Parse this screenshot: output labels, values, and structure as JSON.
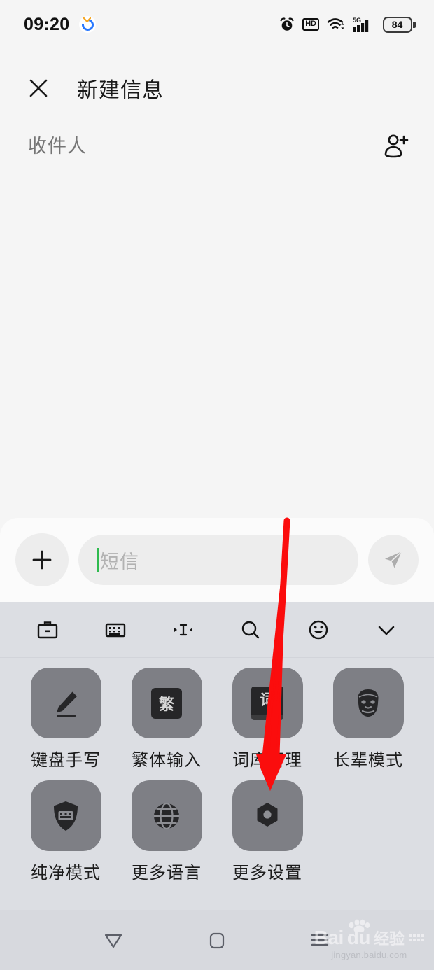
{
  "status_bar": {
    "time": "09:20",
    "app_badge_icon": "circular-app-icon",
    "alarm_icon": "alarm-clock-icon",
    "hd_label": "HD",
    "wifi_icon": "wifi-icon",
    "network_label": "5G",
    "signal_icon": "signal-bars-icon",
    "battery_level": "84"
  },
  "header": {
    "close_icon": "close-icon",
    "title": "新建信息"
  },
  "recipient": {
    "placeholder": "收件人",
    "value": "",
    "add_contact_icon": "add-contact-icon"
  },
  "input_bar": {
    "plus_label": "+",
    "message_placeholder": "短信",
    "message_value": "",
    "caret_color": "#2fbb4f",
    "send_icon": "send-icon"
  },
  "keyboard": {
    "panel_color": "#dcdee3",
    "tile_color": "#7e7f85",
    "toolbar": [
      {
        "name": "toolbox-icon",
        "label": "工具箱"
      },
      {
        "name": "keyboard-icon",
        "label": "键盘"
      },
      {
        "name": "cursor-move-icon",
        "label": "移动光标"
      },
      {
        "name": "search-icon",
        "label": "搜索"
      },
      {
        "name": "emoji-icon",
        "label": "表情"
      },
      {
        "name": "chevron-down-icon",
        "label": "收起"
      }
    ],
    "items": [
      {
        "label": "键盘手写",
        "icon": "pencil-icon",
        "glyph": ""
      },
      {
        "label": "繁体输入",
        "icon": "traditional-char-icon",
        "glyph": "繁"
      },
      {
        "label": "词库管理",
        "icon": "dictionary-book-icon",
        "glyph": "词"
      },
      {
        "label": "长辈模式",
        "icon": "elder-face-icon",
        "glyph": ""
      },
      {
        "label": "纯净模式",
        "icon": "shield-keyboard-icon",
        "glyph": ""
      },
      {
        "label": "更多语言",
        "icon": "globe-icon",
        "glyph": ""
      },
      {
        "label": "更多设置",
        "icon": "hex-nut-settings-icon",
        "glyph": ""
      }
    ]
  },
  "nav_bar": {
    "back_icon": "back-triangle-icon",
    "home_icon": "home-square-icon",
    "recents_icon": "recents-hamburger-icon"
  },
  "watermark": {
    "brand": "Bai",
    "brand2": "du",
    "cn": "经验",
    "url": "jingyan.baidu.com"
  },
  "annotation": {
    "arrow_color": "#fb0d0d",
    "arrow_target": "更多设置"
  }
}
